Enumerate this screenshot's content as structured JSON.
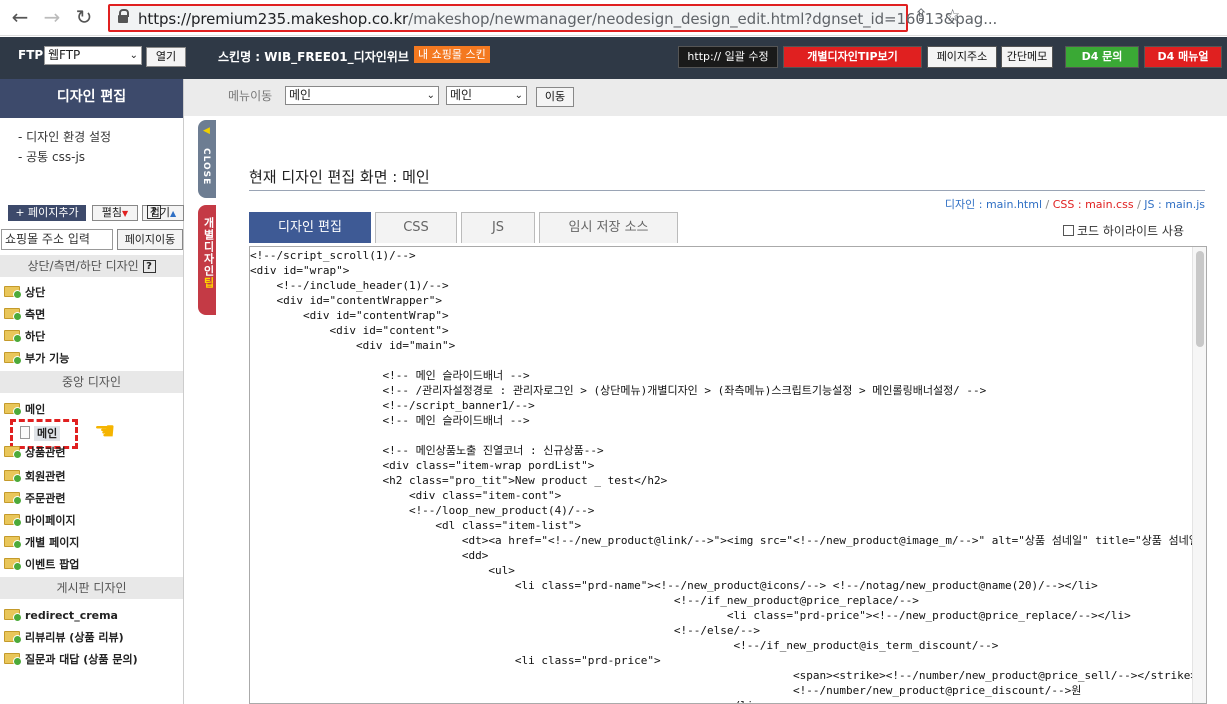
{
  "browser": {
    "url_main": "https://premium235.makeshop.co.kr",
    "url_rest": "/makeshop/newmanager/neodesign_design_edit.html?dgnset_id=16013&pag..."
  },
  "topbar": {
    "ftp_label": "FTP",
    "ftp_select": "웹FTP",
    "open_btn": "열기",
    "skin_name": "스킨명 : WIB_FREE01_디자인위브",
    "skin_badge": "내 쇼핑몰 스킨",
    "btn_http": "http:// 일괄 수정",
    "btn_tip": "개별디자인TIP보기",
    "btn_page_addr": "페이지주소",
    "btn_memo": "간단메모",
    "btn_d4_inquiry": "D4 문의",
    "btn_d4_manual": "D4 매뉴얼"
  },
  "sidebar": {
    "title": "디자인 편집",
    "links": [
      "-  디자인 환경 설정",
      "-  공통 css-js"
    ],
    "add_page": "+ 페이지추가",
    "expand": "펼침",
    "collapse": "접기",
    "help": "?",
    "addr_input": "쇼핑몰 주소 입력",
    "page_move": "페이지이동",
    "sections": {
      "top": "상단/측면/하단 디자인",
      "center": "중앙 디자인",
      "board": "게시판 디자인"
    },
    "tree_top": [
      "상단",
      "측면",
      "하단",
      "부가 기능"
    ],
    "tree_center": [
      "메인",
      "상품관련",
      "회원관련",
      "주문관련",
      "마이페이지",
      "개별 페이지",
      "이벤트 팝업"
    ],
    "file_selected": "메인",
    "tree_board": [
      "redirect_crema",
      "리뷰리뷰 (상품 리뷰)",
      "질문과 대답 (상품 문의)"
    ]
  },
  "side_tabs": {
    "close": "CLOSE",
    "tip_a": "개별디자인",
    "tip_b": "팁"
  },
  "menubar": {
    "label": "메뉴이동",
    "sel1": "메인",
    "sel2": "메인",
    "move_btn": "이동"
  },
  "main": {
    "title": "현재 디자인 편집 화면 : 메인",
    "design_link": "디자인 : main.html",
    "css_link": "CSS : main.css",
    "js_link": "JS : main.js",
    "sep": "/",
    "tabs": [
      "디자인 편집",
      "CSS",
      "JS",
      "임시 저장 소스"
    ],
    "highlight_label": "코드 하이라이트 사용",
    "code": "<!--/script_scroll(1)/-->\n<div id=\"wrap\">\n    <!--/include_header(1)/-->\n    <div id=\"contentWrapper\">\n        <div id=\"contentWrap\">\n            <div id=\"content\">\n                <div id=\"main\">\n\n                    <!-- 메인 슬라이드배너 -->\n                    <!-- /관리자설정경로 : 관리자로그인 > (상단메뉴)개별디자인 > (좌측메뉴)스크립트기능설정 > 메인롤링배너설정/ -->\n                    <!--/script_banner1/-->\n                    <!-- 메인 슬라이드배너 -->\n\n                    <!-- 메인상품노출 진열코너 : 신규상품-->\n                    <div class=\"item-wrap pordList\">\n                    <h2 class=\"pro_tit\">New product _ test</h2>\n                        <div class=\"item-cont\">\n                        <!--/loop_new_product(4)/-->\n                            <dl class=\"item-list\">\n                                <dt><a href=\"<!--/new_product@link/-->\"><img src=\"<!--/new_product@image_m/-->\" alt=\"상품 섬네일\" title=\"상품 섬네일\" /></a></dt>\n                                <dd>\n                                    <ul>\n                                        <li class=\"prd-name\"><!--/new_product@icons/--> <!--/notag/new_product@name(20)/--></li>\n                                                                <!--/if_new_product@price_replace/-->\n                                                                        <li class=\"prd-price\"><!--/new_product@price_replace/--></li>\n                                                                <!--/else/-->\n                                                                         <!--/if_new_product@is_term_discount/-->\n                                        <li class=\"prd-price\">\n                                                                                  <span><strike><!--/number/new_product@price_sell/--></strike></span>\n                                                                                  <!--/number/new_product@price_discount/-->원\n                                                                        </li>"
  }
}
